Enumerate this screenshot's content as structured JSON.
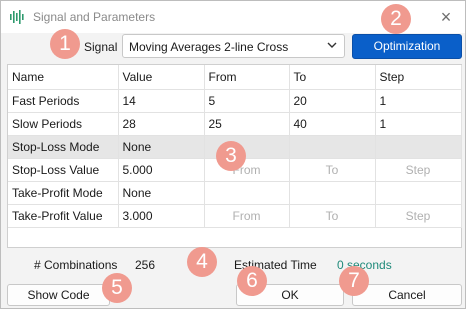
{
  "window": {
    "title": "Signal and Parameters",
    "close_glyph": "×"
  },
  "signal": {
    "label": "Signal",
    "selected": "Moving Averages 2-line Cross"
  },
  "optimization_button": "Optimization",
  "table": {
    "columns": [
      "Name",
      "Value",
      "From",
      "To",
      "Step"
    ],
    "rows": [
      [
        "Fast Periods",
        "14",
        "5",
        "20",
        "1"
      ],
      [
        "Slow Periods",
        "28",
        "25",
        "40",
        "1"
      ],
      [
        "Stop-Loss Mode",
        "None",
        "",
        "",
        ""
      ],
      [
        "Stop-Loss Value",
        "5.000",
        "From",
        "To",
        "Step"
      ],
      [
        "Take-Profit Mode",
        "None",
        "",
        "",
        ""
      ],
      [
        "Take-Profit Value",
        "3.000",
        "From",
        "To",
        "Step"
      ]
    ]
  },
  "footer": {
    "combinations_label": "# Combinations",
    "combinations_value": "256",
    "estimated_label": "Estimated Time",
    "estimated_value": "0 seconds"
  },
  "buttons": {
    "show_code": "Show Code",
    "ok": "OK",
    "cancel": "Cancel"
  },
  "badges": [
    "1",
    "2",
    "3",
    "4",
    "5",
    "6",
    "7"
  ],
  "colors": {
    "accent": "#0a5fc9",
    "badge": "#f09a8f",
    "estimated_value": "#1f8a7a",
    "highlight_row": "#e6e6e6"
  },
  "icons": {
    "app": "signal-waveform-icon",
    "close": "close-icon",
    "dropdown": "chevron-down-icon"
  }
}
